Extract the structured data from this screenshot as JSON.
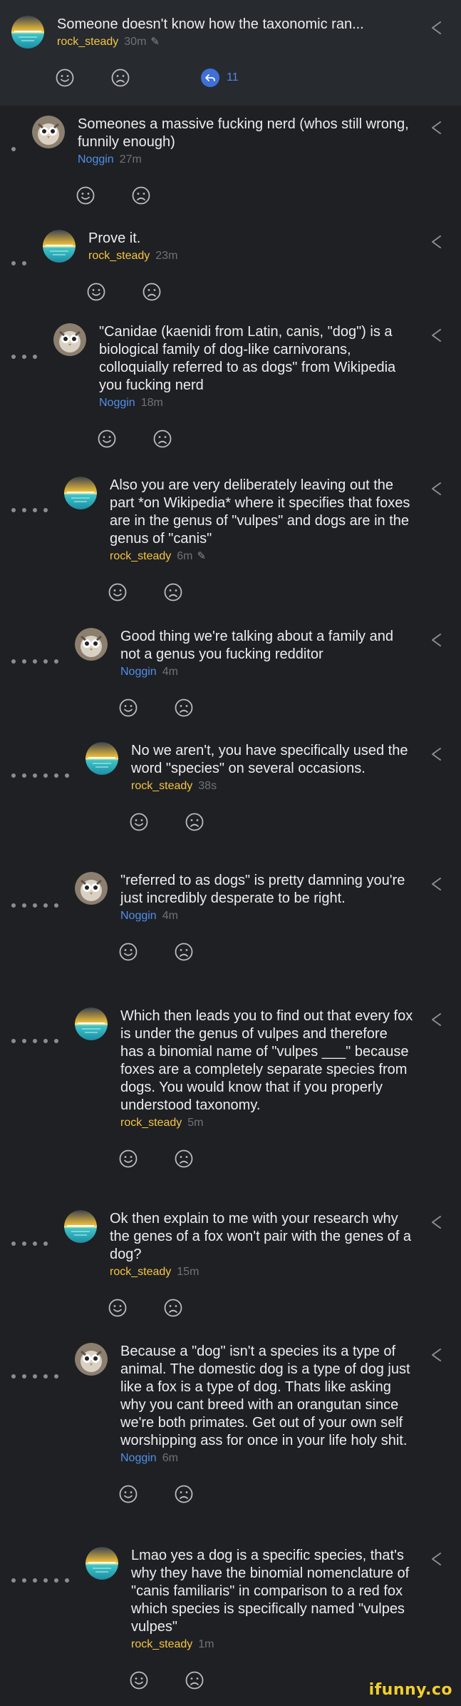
{
  "colors": {
    "rock_steady": "#f4c542",
    "noggin": "#4f8fea",
    "timestamp": "#6f7278",
    "background": "#1f2023",
    "highlight_bar": "#272a2f",
    "ifunny_logo": "#f2cf2c"
  },
  "comments": [
    {
      "depth": 0,
      "user": "rock_steady",
      "avatar": "sunset-avatar",
      "text": "Someone doesn't know how the taxonomic ran...",
      "time": "30m",
      "edited": true,
      "reply_count": "11"
    },
    {
      "depth": 1,
      "user": "Noggin",
      "avatar": "owl-avatar",
      "text": "Someones a massive fucking nerd (whos still wrong, funnily enough)",
      "time": "27m",
      "edited": false
    },
    {
      "depth": 2,
      "user": "rock_steady",
      "avatar": "sunset-avatar",
      "text": "Prove it.",
      "time": "23m",
      "edited": false
    },
    {
      "depth": 3,
      "user": "Noggin",
      "avatar": "owl-avatar",
      "text": "\"Canidae (kaenidi from Latin, canis, \"dog\") is a biological family of dog-like carnivorans, colloquially referred to as dogs\" from Wikipedia you fucking nerd",
      "time": "18m",
      "edited": false
    },
    {
      "depth": 4,
      "user": "rock_steady",
      "avatar": "sunset-avatar",
      "text": "Also you are very deliberately leaving out the part *on Wikipedia* where it specifies that foxes are in the genus of \"vulpes\" and dogs are in the genus of \"canis\"",
      "time": "6m",
      "edited": true
    },
    {
      "depth": 5,
      "user": "Noggin",
      "avatar": "owl-avatar",
      "text": "Good thing we're talking about a family and not a genus you fucking redditor",
      "time": "4m",
      "edited": false
    },
    {
      "depth": 6,
      "user": "rock_steady",
      "avatar": "sunset-avatar",
      "text": "No we aren't, you have specifically used the word \"species\" on several occasions.",
      "time": "38s",
      "edited": false
    },
    {
      "depth": 5,
      "user": "Noggin",
      "avatar": "owl-avatar",
      "text": "\"referred to as dogs\" is pretty damning you're just incredibly desperate to be right.",
      "time": "4m",
      "edited": false
    },
    {
      "depth": 5,
      "user": "rock_steady",
      "avatar": "sunset-avatar",
      "text": "Which then leads you to find out that every fox is under the genus of vulpes and therefore has a binomial name of \"vulpes ___\" because foxes are a completely separate species from dogs. You would know that if you properly understood taxonomy.",
      "time": "5m",
      "edited": false
    },
    {
      "depth": 4,
      "user": "rock_steady",
      "avatar": "sunset-avatar",
      "text": "Ok then explain to me with your research why the genes of a fox won't pair with the genes of a dog?",
      "time": "15m",
      "edited": false
    },
    {
      "depth": 5,
      "user": "Noggin",
      "avatar": "owl-avatar",
      "text": "Because a \"dog\" isn't a species its a type of animal. The domestic dog is a type of dog just like a fox is a type of dog. Thats like asking why you cant breed with an orangutan since we're both primates. Get out of your own self worshipping ass for once in your life holy shit.",
      "time": "6m",
      "edited": false
    },
    {
      "depth": 6,
      "user": "rock_steady",
      "avatar": "sunset-avatar",
      "text": "Lmao yes a dog is a specific species, that's why they have the binomial nomenclature of \"canis familiaris\" in comparison to a red fox which species is specifically named \"vulpes vulpes\"",
      "time": "1m",
      "edited": false
    }
  ],
  "icons": {
    "smile": "smile-icon",
    "frown": "frown-icon",
    "reply": "reply-arrow-icon",
    "edited": "pencil-icon",
    "replies": "replies-icon"
  },
  "logo": "ifunny.co"
}
